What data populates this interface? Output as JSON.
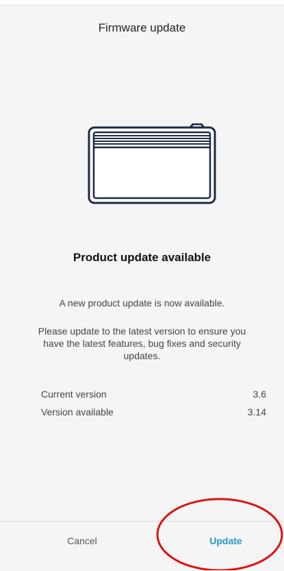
{
  "header": {
    "title": "Firmware update"
  },
  "illustration": {
    "icon": "panel-heater-icon",
    "stroke_color": "#1e2a44"
  },
  "content": {
    "heading": "Product update available",
    "description_1": "A new product update is now available.",
    "description_2": "Please update to the latest version to ensure you have the latest features, bug fixes and security updates."
  },
  "versions": {
    "current_label": "Current version",
    "current_value": "3.6",
    "available_label": "Version available",
    "available_value": "3.14"
  },
  "actions": {
    "cancel_label": "Cancel",
    "update_label": "Update",
    "accent_color": "#2196c9"
  },
  "annotation": {
    "type": "red-circle-highlight",
    "color": "#e01010"
  }
}
